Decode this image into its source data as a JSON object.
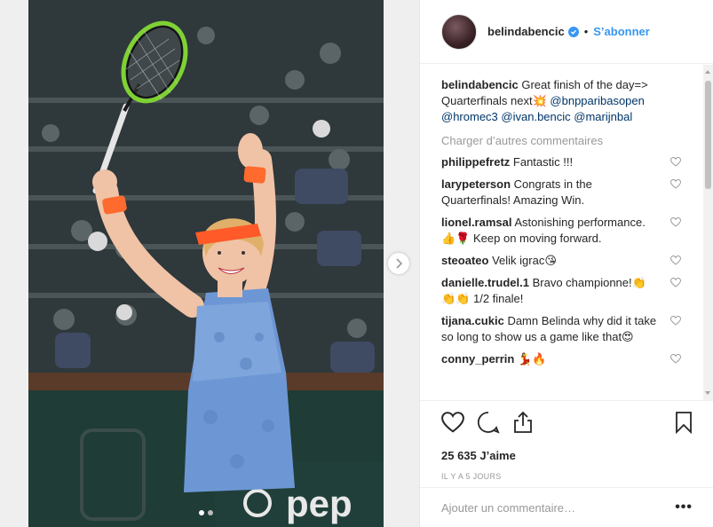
{
  "post": {
    "username": "belindabencic",
    "verified": true,
    "separator": "•",
    "follow_label": "S’abonner",
    "caption_user": "belindabencic",
    "caption_text": "Great finish of the day=> Quarterfinals next💥",
    "caption_tags": [
      "@bnpparibasopen",
      "@hromec3",
      "@ivan.bencic",
      "@marijnbal"
    ],
    "load_more": "Charger d’autres commentaires",
    "comments": [
      {
        "user": "philippefretz",
        "text": "Fantastic !!!"
      },
      {
        "user": "larypeterson",
        "text": "Congrats in the Quarterfinals! Amazing Win."
      },
      {
        "user": "lionel.ramsal",
        "text": "Astonishing performance. 👍🌹 Keep on moving forward."
      },
      {
        "user": "steoateo",
        "text": "Velik igrac😘"
      },
      {
        "user": "danielle.trudel.1",
        "text": "Bravo championne!👏 👏👏 1/2 finale!"
      },
      {
        "user": "tijana.cukic",
        "text": "Damn Belinda why did it take so long to show us a game like that😍"
      },
      {
        "user": "conny_perrin",
        "text": "💃🔥"
      }
    ],
    "likes": "25 635 J’aime",
    "time": "IL Y A 5 JOURS",
    "add_comment_placeholder": "Ajouter un commentaire…",
    "more_options": "•••"
  },
  "media": {
    "banner_text": "pep",
    "carousel_count": 2,
    "carousel_active": 1
  },
  "icons": {
    "like": "heart-icon",
    "comment": "comment-icon",
    "share": "share-icon",
    "save": "bookmark-icon",
    "next": "chevron-right-icon",
    "verified": "verified-badge-icon"
  },
  "colors": {
    "link": "#3897f0",
    "tag": "#003569",
    "muted": "#999999",
    "text": "#262626"
  }
}
